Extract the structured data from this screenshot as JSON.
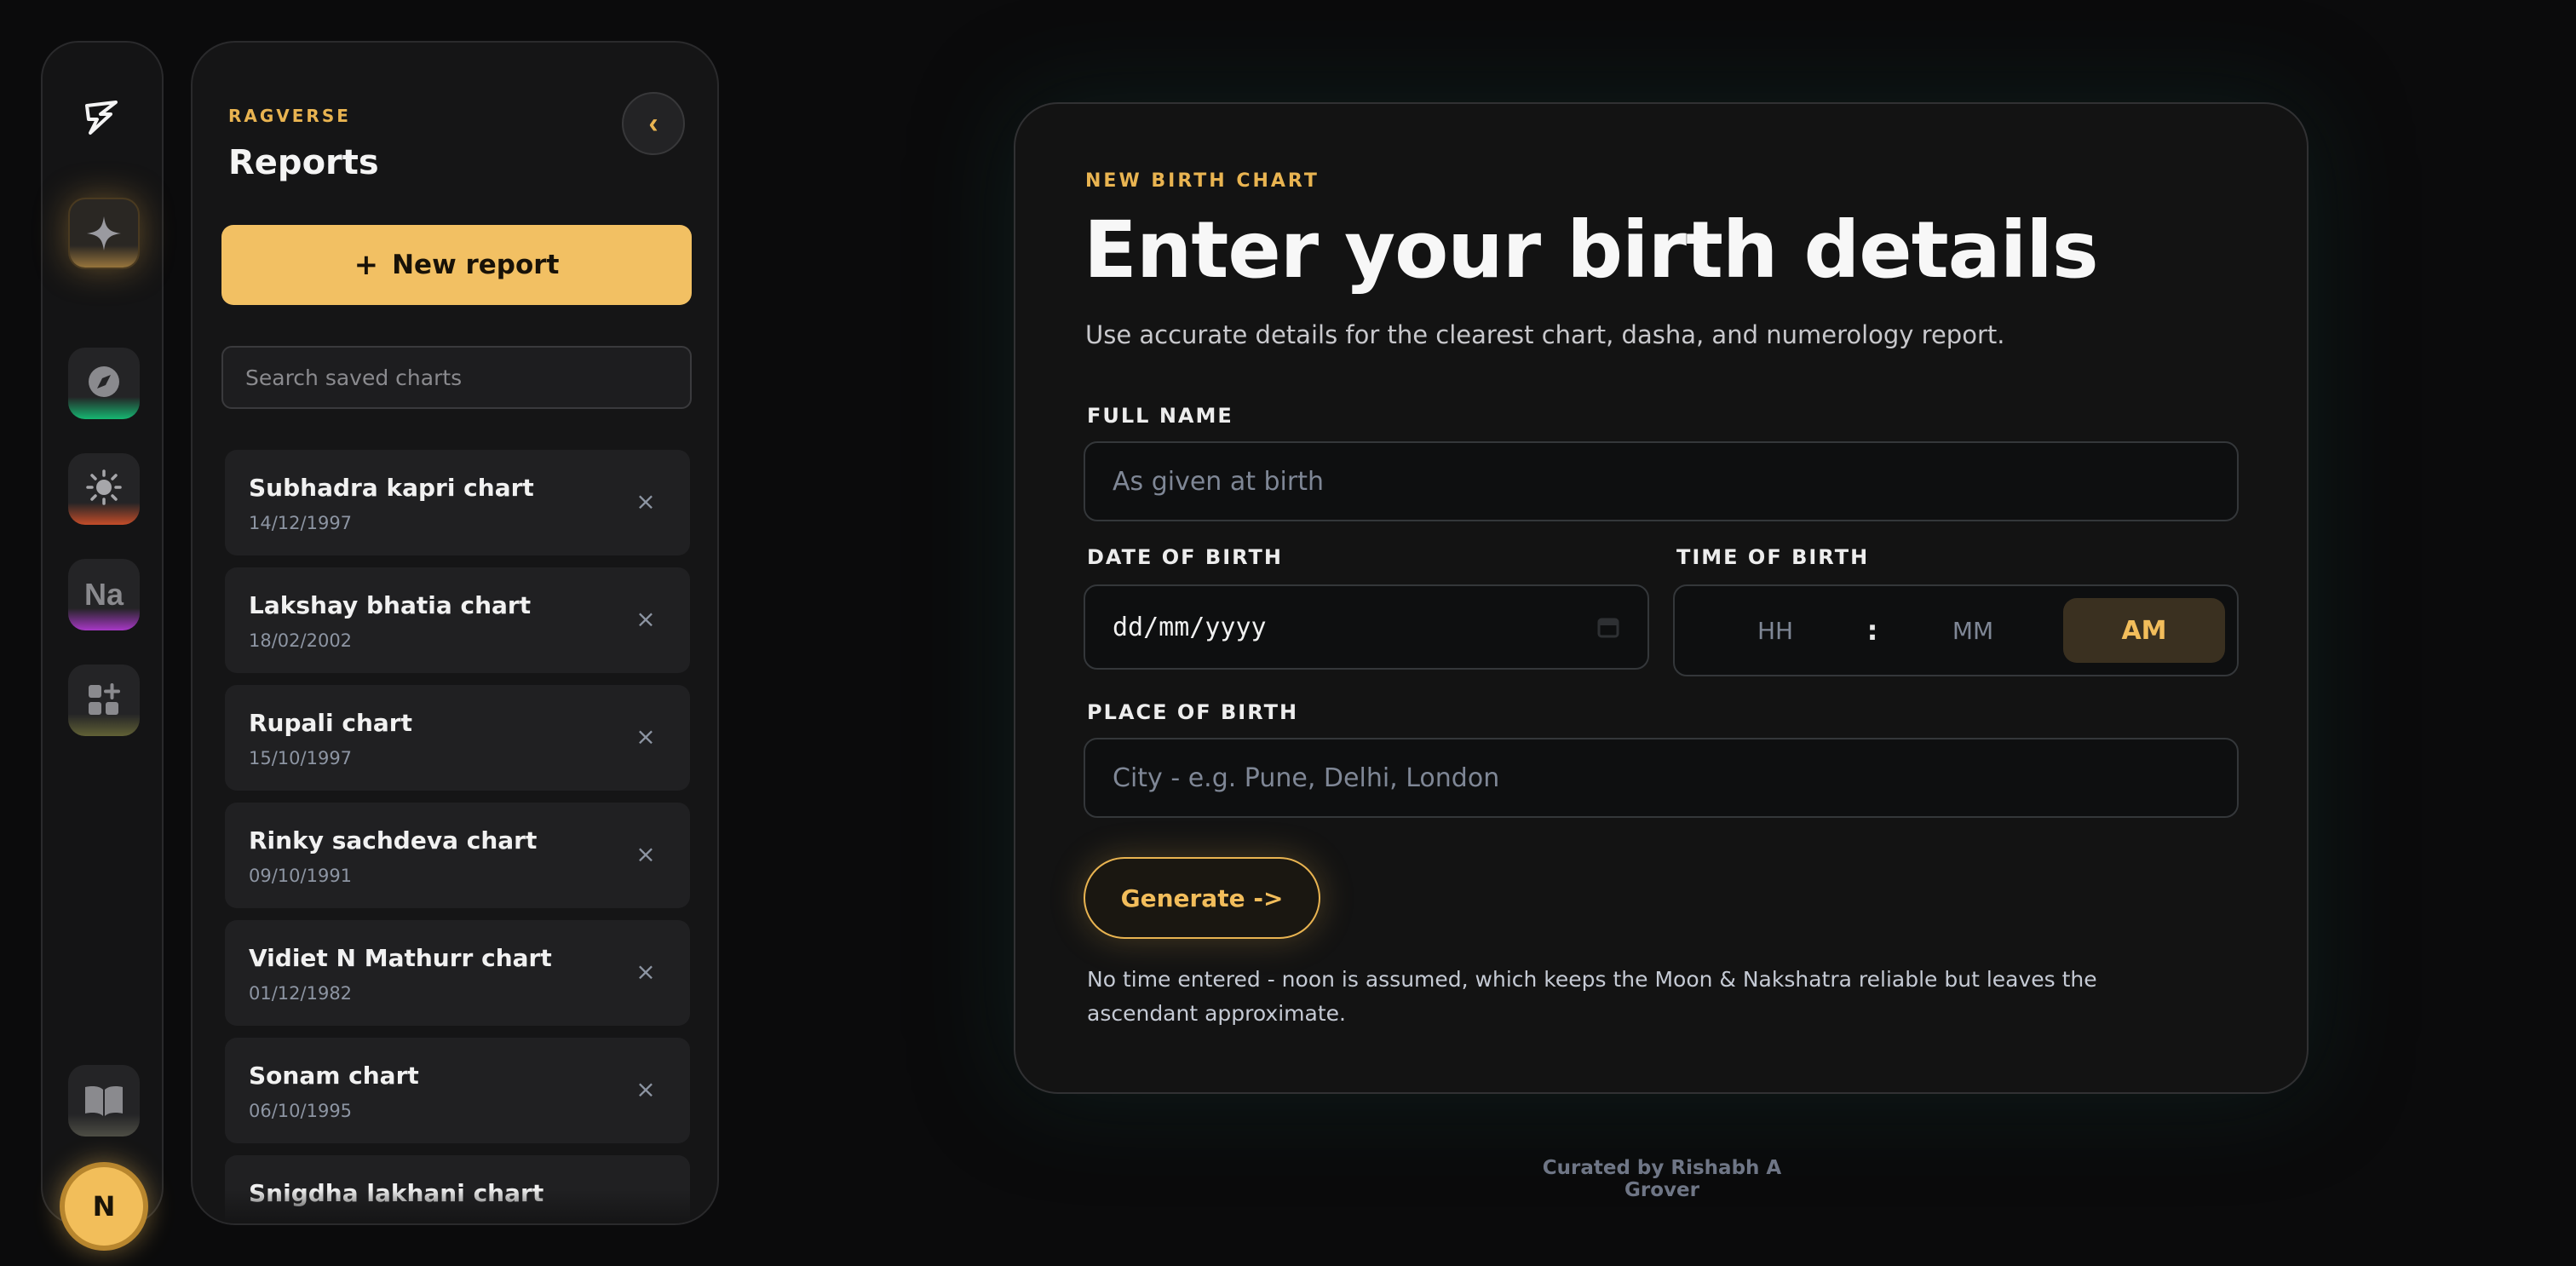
{
  "rail": {
    "icons": [
      "logo-icon",
      "sparkle-icon",
      "compass-icon",
      "sun-icon",
      "nakshatra-icon",
      "apps-add-icon",
      "book-icon"
    ],
    "na_label": "Na",
    "avatar_initial": "N",
    "glow_colors": {
      "compass": "#15c77a",
      "sun": "#e0542a",
      "nakshatra": "#b63ad8",
      "apps": "#8a8a40",
      "book": "#6a6a5a"
    }
  },
  "sidebar": {
    "eyebrow": "RAGVERSE",
    "title": "Reports",
    "collapse_glyph": "‹",
    "new_report_label": "New report",
    "new_report_icon": "+",
    "search_placeholder": "Search saved charts",
    "close_glyph": "×",
    "reports": [
      {
        "name": "Subhadra kapri chart",
        "date": "14/12/1997"
      },
      {
        "name": "Lakshay bhatia chart",
        "date": "18/02/2002"
      },
      {
        "name": "Rupali chart",
        "date": "15/10/1997"
      },
      {
        "name": "Rinky sachdeva chart",
        "date": "09/10/1991"
      },
      {
        "name": "Vidiet N Mathurr chart",
        "date": "01/12/1982"
      },
      {
        "name": "Sonam chart",
        "date": "06/10/1995"
      },
      {
        "name": "Snigdha lakhani chart",
        "date": ""
      }
    ]
  },
  "form": {
    "eyebrow": "NEW BIRTH CHART",
    "title": "Enter your birth details",
    "subtitle": "Use accurate details for the clearest chart, dasha, and numerology report.",
    "full_name_label": "FULL NAME",
    "full_name_placeholder": "As given at birth",
    "dob_label": "DATE OF BIRTH",
    "dob_value": "dd/mm/yyyy",
    "tob_label": "TIME OF BIRTH",
    "hh_placeholder": "HH",
    "time_separator": ":",
    "mm_placeholder": "MM",
    "ampm_value": "AM",
    "pob_label": "PLACE OF BIRTH",
    "pob_placeholder": "City - e.g. Pune, Delhi, London",
    "generate_label": "Generate ->",
    "note": "No time entered - noon is assumed, which keeps the Moon & Nakshatra reliable but leaves the ascendant approximate."
  },
  "footer": {
    "credit": "Curated by Rishabh A Grover"
  },
  "colors": {
    "accent": "#e9b451",
    "accent_fill": "#f2c063",
    "bg": "#0b0b0c",
    "panel": "#151516"
  }
}
